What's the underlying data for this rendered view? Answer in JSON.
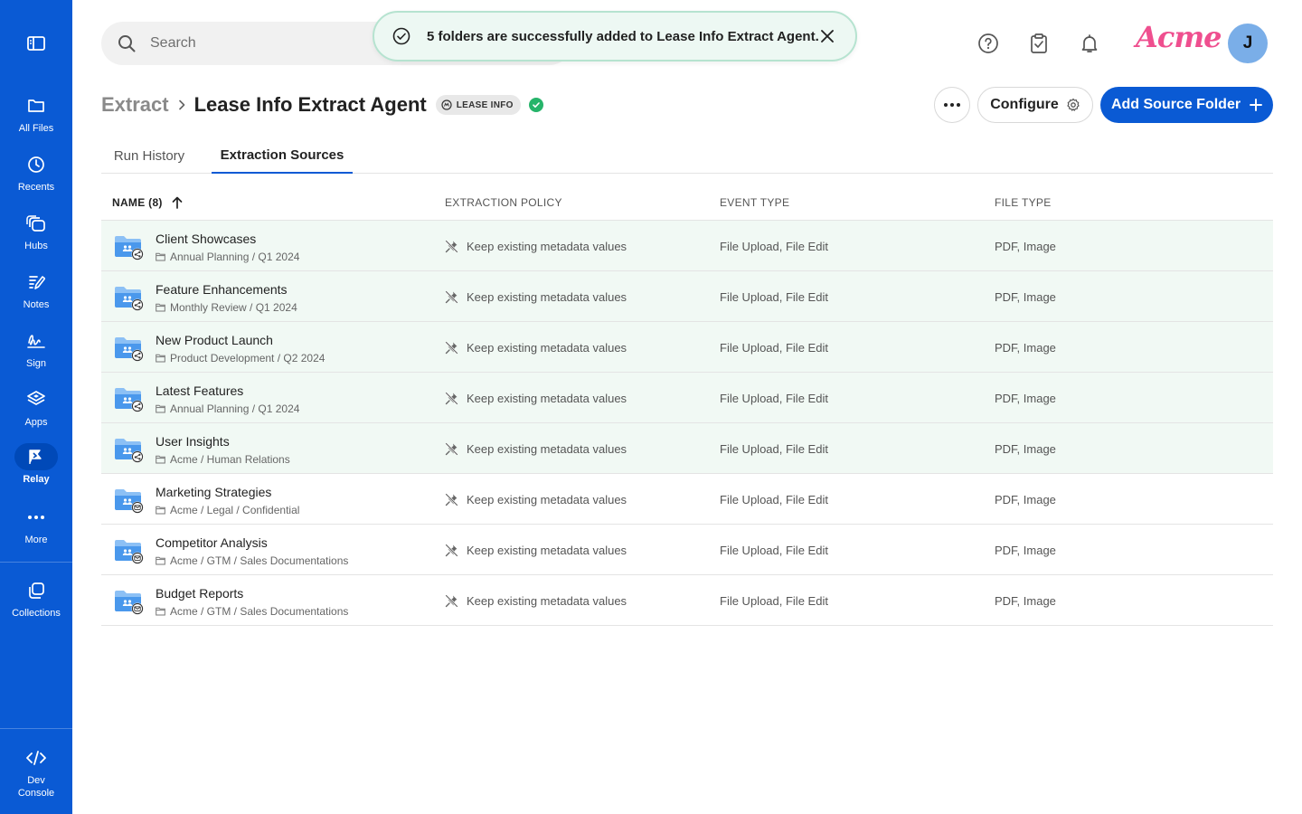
{
  "sidebar": {
    "toggle_icon": "sidebar-toggle-icon",
    "items": [
      {
        "label": "All Files",
        "icon": "folder-icon"
      },
      {
        "label": "Recents",
        "icon": "clock-icon"
      },
      {
        "label": "Hubs",
        "icon": "hubs-icon"
      },
      {
        "label": "Notes",
        "icon": "notes-icon"
      },
      {
        "label": "Sign",
        "icon": "sign-icon"
      },
      {
        "label": "Apps",
        "icon": "apps-icon"
      },
      {
        "label": "Relay",
        "icon": "relay-icon",
        "active": true
      },
      {
        "label": "More",
        "icon": "more-icon"
      },
      {
        "label": "Collections",
        "icon": "collections-icon"
      }
    ],
    "dev_console": {
      "line1": "Dev",
      "line2": "Console"
    }
  },
  "header": {
    "search_placeholder": "Search",
    "toast_message": "5 folders are successfully added to Lease Info Extract Agent.",
    "logo_text": "Acme",
    "avatar_initial": "J"
  },
  "title_row": {
    "parent": "Extract",
    "title": "Lease Info Extract Agent",
    "badge": "LEASE INFO",
    "configure_label": "Configure",
    "add_label": "Add Source Folder"
  },
  "tabs": [
    "Run History",
    "Extraction Sources"
  ],
  "active_tab": "Extraction Sources",
  "table": {
    "headers": {
      "name": "NAME (8)",
      "policy": "EXTRACTION POLICY",
      "event": "EVENT TYPE",
      "file": "FILE TYPE"
    },
    "rows": [
      {
        "name": "Client Showcases",
        "path": "Annual Planning / Q1 2024",
        "policy": "Keep existing metadata values",
        "event": "File Upload, File Edit",
        "file": "PDF, Image",
        "new": true,
        "badge": "shared"
      },
      {
        "name": "Feature Enhancements",
        "path": "Monthly Review / Q1 2024",
        "policy": "Keep existing metadata values",
        "event": "File Upload, File Edit",
        "file": "PDF, Image",
        "new": true,
        "badge": "shared"
      },
      {
        "name": "New Product Launch",
        "path": "Product Development / Q2 2024",
        "policy": "Keep existing metadata values",
        "event": "File Upload, File Edit",
        "file": "PDF, Image",
        "new": true,
        "badge": "shared"
      },
      {
        "name": "Latest Features",
        "path": "Annual Planning / Q1 2024",
        "policy": "Keep existing metadata values",
        "event": "File Upload, File Edit",
        "file": "PDF, Image",
        "new": true,
        "badge": "shared"
      },
      {
        "name": "User Insights",
        "path": "Acme / Human Relations",
        "policy": "Keep existing metadata values",
        "event": "File Upload, File Edit",
        "file": "PDF, Image",
        "new": true,
        "badge": "shared"
      },
      {
        "name": "Marketing Strategies",
        "path": "Acme / Legal / Confidential",
        "policy": "Keep existing metadata values",
        "event": "File Upload, File Edit",
        "file": "PDF, Image",
        "new": false,
        "badge": "mail"
      },
      {
        "name": "Competitor Analysis",
        "path": "Acme / GTM / Sales Documentations",
        "policy": "Keep existing metadata values",
        "event": "File Upload, File Edit",
        "file": "PDF, Image",
        "new": false,
        "badge": "mail"
      },
      {
        "name": "Budget Reports",
        "path": "Acme / GTM / Sales Documentations",
        "policy": "Keep existing metadata values",
        "event": "File Upload, File Edit",
        "file": "PDF, Image",
        "new": false,
        "badge": "mail"
      }
    ]
  },
  "colors": {
    "primary": "#0a5ad4",
    "success": "#26b46a",
    "new_row_bg": "#f1f9f4",
    "logo": "#ef4f8f"
  }
}
